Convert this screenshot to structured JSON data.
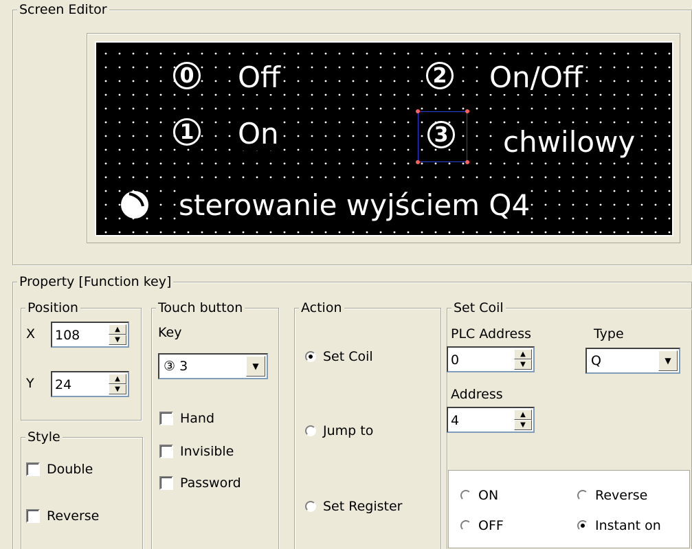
{
  "screen_editor": {
    "title": "Screen Editor",
    "lcd": {
      "key0_num": "0",
      "key0_label": "Off",
      "key1_num": "1",
      "key1_label": "On",
      "key2_num": "2",
      "key2_label": "On/Off",
      "key3_num": "3",
      "key3_label": "chwilowy",
      "footer_text": "sterowanie wyjściem Q4",
      "footer_icon": "knob-icon"
    }
  },
  "property": {
    "title": "Property  [Function key]",
    "position": {
      "title": "Position",
      "x_label": "X",
      "x_value": "108",
      "y_label": "Y",
      "y_value": "24"
    },
    "style": {
      "title": "Style",
      "double_label": "Double",
      "reverse_label": "Reverse"
    },
    "touch_button": {
      "title": "Touch button",
      "key_label": "Key",
      "key_value": "③ 3",
      "hand_label": "Hand",
      "invisible_label": "Invisible",
      "password_label": "Password"
    },
    "action": {
      "title": "Action",
      "options": [
        "Set Coil",
        "Jump to",
        "Set Register"
      ],
      "selected": "Set Coil"
    },
    "set_coil": {
      "title": "Set Coil",
      "plc_address_label": "PLC Address",
      "plc_address_value": "0",
      "type_label": "Type",
      "type_value": "Q",
      "address_label": "Address",
      "address_value": "4",
      "mode_on": "ON",
      "mode_off": "OFF",
      "mode_reverse": "Reverse",
      "mode_instant": "Instant on",
      "selected_mode": "Instant on"
    }
  }
}
